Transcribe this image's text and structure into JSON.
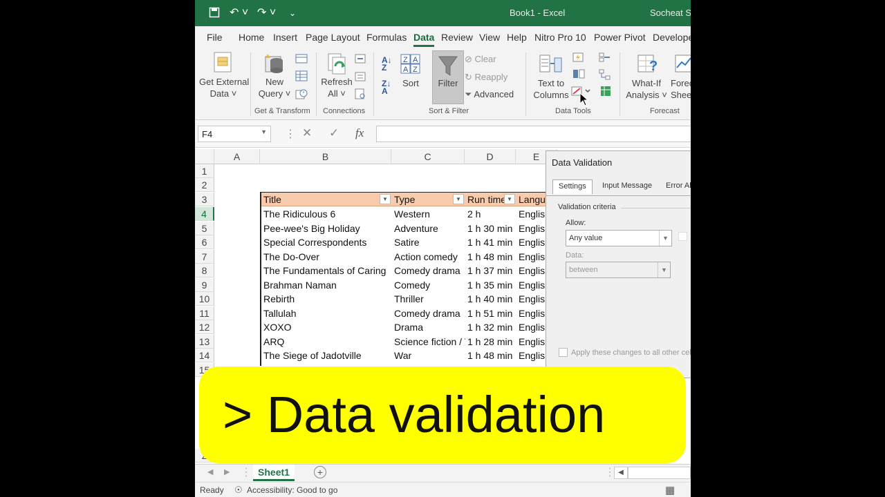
{
  "window": {
    "doc_title": "Book1  -  Excel",
    "user": "Socheat So"
  },
  "ribbon_tabs": [
    "File",
    "Home",
    "Insert",
    "Page Layout",
    "Formulas",
    "Data",
    "Review",
    "View",
    "Help",
    "Nitro Pro 10",
    "Power Pivot",
    "Develope"
  ],
  "active_tab": "Data",
  "ribbon": {
    "get_external_data": [
      "Get External",
      "Data ˅"
    ],
    "new_query": [
      "New",
      "Query ˅"
    ],
    "refresh_all": [
      "Refresh",
      "All ˅"
    ],
    "sort": "Sort",
    "filter": "Filter",
    "clear": "Clear",
    "reapply": "Reapply",
    "advanced": "Advanced",
    "text_to_columns": [
      "Text to",
      "Columns"
    ],
    "what_if": [
      "What-If",
      "Analysis ˅"
    ],
    "forecast_sheet": [
      "Forec",
      "Shee"
    ],
    "groups": {
      "get_transform": "Get & Transform",
      "connections": "Connections",
      "sort_filter": "Sort & Filter",
      "data_tools": "Data Tools",
      "forecast": "Forecast"
    }
  },
  "formula_bar": {
    "name_box": "F4",
    "cancel": "✕",
    "enter": "✓",
    "fx": "fx",
    "formula": ""
  },
  "columns": [
    "A",
    "B",
    "C",
    "D",
    "E"
  ],
  "rows": [
    "1",
    "2",
    "3",
    "4",
    "5",
    "6",
    "7",
    "8",
    "9",
    "10",
    "11",
    "12",
    "13",
    "14",
    "15",
    "2"
  ],
  "selected_row": "4",
  "table": {
    "headers": [
      "Title",
      "Type",
      "Run time",
      "Langua"
    ],
    "rows": [
      [
        "The Ridiculous 6",
        "Western",
        "2 h",
        "English"
      ],
      [
        "Pee-wee's Big Holiday",
        "Adventure",
        "1 h 30 min",
        "English"
      ],
      [
        "Special Correspondents",
        "Satire",
        "1 h 41 min",
        "English"
      ],
      [
        "The Do-Over",
        "Action comedy",
        "1 h 48 min",
        "English"
      ],
      [
        "The Fundamentals of Caring",
        "Comedy drama",
        "1 h 37 min",
        "English"
      ],
      [
        "Brahman Naman",
        "Comedy",
        "1 h 35 min",
        "English"
      ],
      [
        "Rebirth",
        "Thriller",
        "1 h 40 min",
        "English"
      ],
      [
        "Tallulah",
        "Comedy drama",
        "1 h 51 min",
        "English"
      ],
      [
        "XOXO",
        "Drama",
        "1 h 32 min",
        "English"
      ],
      [
        "ARQ",
        "Science fiction / T",
        "1 h 28 min",
        "English"
      ],
      [
        "The Siege of Jadotville",
        "War",
        "1 h 48 min",
        "English"
      ]
    ]
  },
  "dialog": {
    "title": "Data Validation",
    "tabs": [
      "Settings",
      "Input Message",
      "Error Al"
    ],
    "section": "Validation criteria",
    "allow_label": "Allow:",
    "allow_value": "Any value",
    "data_label": "Data:",
    "data_value": "between",
    "apply_all": "Apply these changes to all other cel"
  },
  "sheet_tab": "Sheet1",
  "status": {
    "ready": "Ready",
    "accessibility": "Accessibility: Good to go"
  },
  "caption": "> Data validation"
}
